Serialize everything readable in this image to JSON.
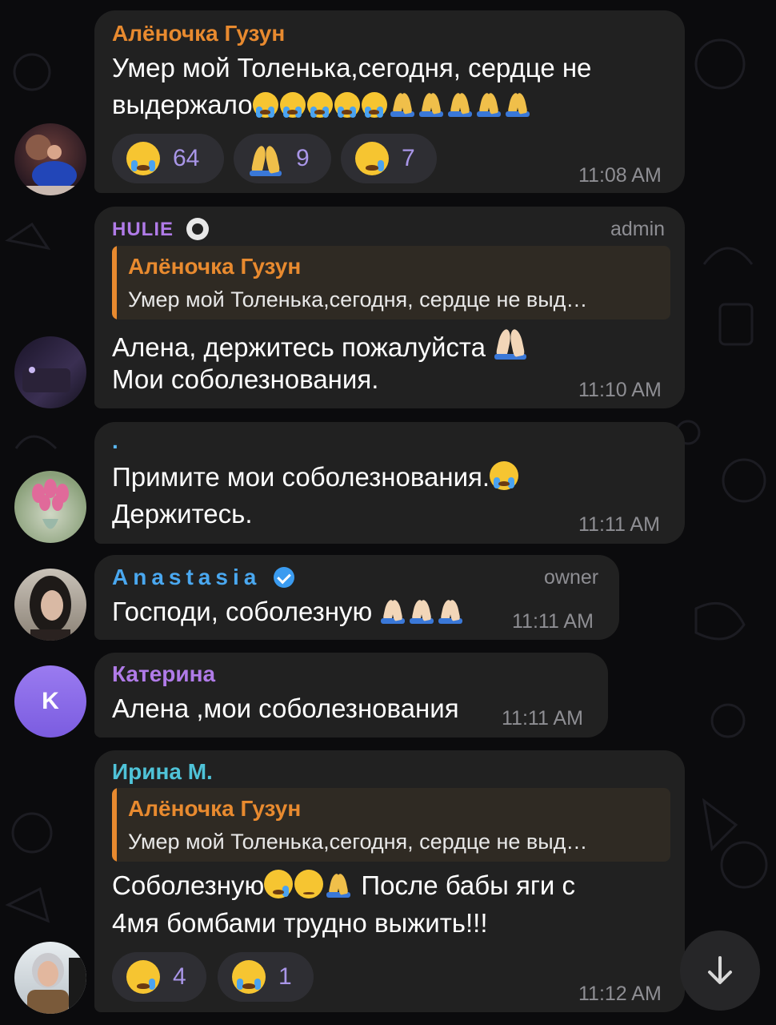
{
  "messages": [
    {
      "sender": "Алёночка Гузун",
      "sender_color": "#e88a2f",
      "text_line1": "Умер мой Толенька,сегодня, сердце не",
      "text_line2": "выдержало",
      "reactions": [
        {
          "emoji": "crying-face",
          "count": "64"
        },
        {
          "emoji": "folded-hands",
          "count": "9"
        },
        {
          "emoji": "sad-tear-face",
          "count": "7"
        }
      ],
      "time": "11:08 AM"
    },
    {
      "sender": "HULIE",
      "sender_color": "#b07be8",
      "role": "admin",
      "reply": {
        "name": "Алёночка Гузун",
        "text": "Умер мой Толенька,сегодня, сердце не выд…"
      },
      "text_line1": "Алена, держитесь пожалуйста",
      "text_line2": "Мои соболезнования.",
      "time": "11:10 AM"
    },
    {
      "sender": ".",
      "sender_color": "#5ab6f0",
      "text_line1": "Примите мои соболезнования.",
      "text_line2": "Держитесь.",
      "time": "11:11 AM"
    },
    {
      "sender": "Anastasia",
      "sender_color": "#4aa8f0",
      "role": "owner",
      "text_line1": "Господи, соболезную",
      "time": "11:11 AM"
    },
    {
      "sender": "Катерина",
      "sender_color": "#b07be8",
      "avatar_letter": "K",
      "text_line1": "Алена ,мои соболезнования",
      "time": "11:11 AM"
    },
    {
      "sender": "Ирина М.",
      "sender_color": "#4fc3d8",
      "reply": {
        "name": "Алёночка Гузун",
        "text": "Умер мой Толенька,сегодня, сердце не выд…"
      },
      "text_line1": "Соболезную",
      "text_line1b": "После бабы яги с",
      "text_line2": "4мя бомбами трудно выжить!!!",
      "reactions": [
        {
          "emoji": "sad-tear-face",
          "count": "4"
        },
        {
          "emoji": "crying-face",
          "count": "1"
        }
      ],
      "time": "11:12 AM"
    }
  ],
  "colors": {
    "background": "#0b0b0d",
    "bubble": "#212121",
    "reaction_count": "#a996e8",
    "time": "#8e8e93"
  }
}
